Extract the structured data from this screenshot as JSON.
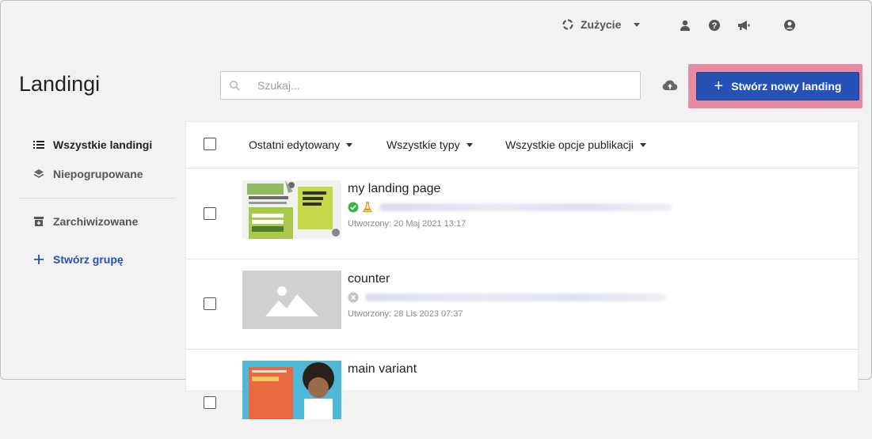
{
  "topbar": {
    "usage_label": "Zużycie",
    "icons": [
      "usage-icon",
      "user-admin-icon",
      "help-icon",
      "megaphone-icon",
      "account-icon"
    ]
  },
  "header": {
    "title": "Landingi",
    "search_placeholder": "Szukaj...",
    "create_button_label": "Stwórz nowy landing"
  },
  "sidebar": {
    "items": [
      {
        "label": "Wszystkie landingi",
        "icon": "list-icon"
      },
      {
        "label": "Niepogrupowane",
        "icon": "layers-icon"
      },
      {
        "label": "Zarchiwizowane",
        "icon": "archive-icon"
      },
      {
        "label": "Stwórz grupę",
        "icon": "plus-icon"
      }
    ]
  },
  "filters": {
    "sort": "Ostatni edytowany",
    "types": "Wszystkie typy",
    "publish": "Wszystkie opcje publikacji"
  },
  "rows": [
    {
      "title": "my landing page",
      "date": "Utworzony: 20 Maj 2021 13:17",
      "status": "published",
      "status_color": "#3bb54a"
    },
    {
      "title": "counter",
      "date": "Utworzony: 28 Lis 2023 07:37",
      "status": "unpublished",
      "status_color": "#c4c4c4"
    },
    {
      "title": "main variant",
      "date": "",
      "status": "",
      "status_color": ""
    }
  ],
  "colors": {
    "accent": "#2552b4",
    "highlight": "#e88ba0"
  }
}
